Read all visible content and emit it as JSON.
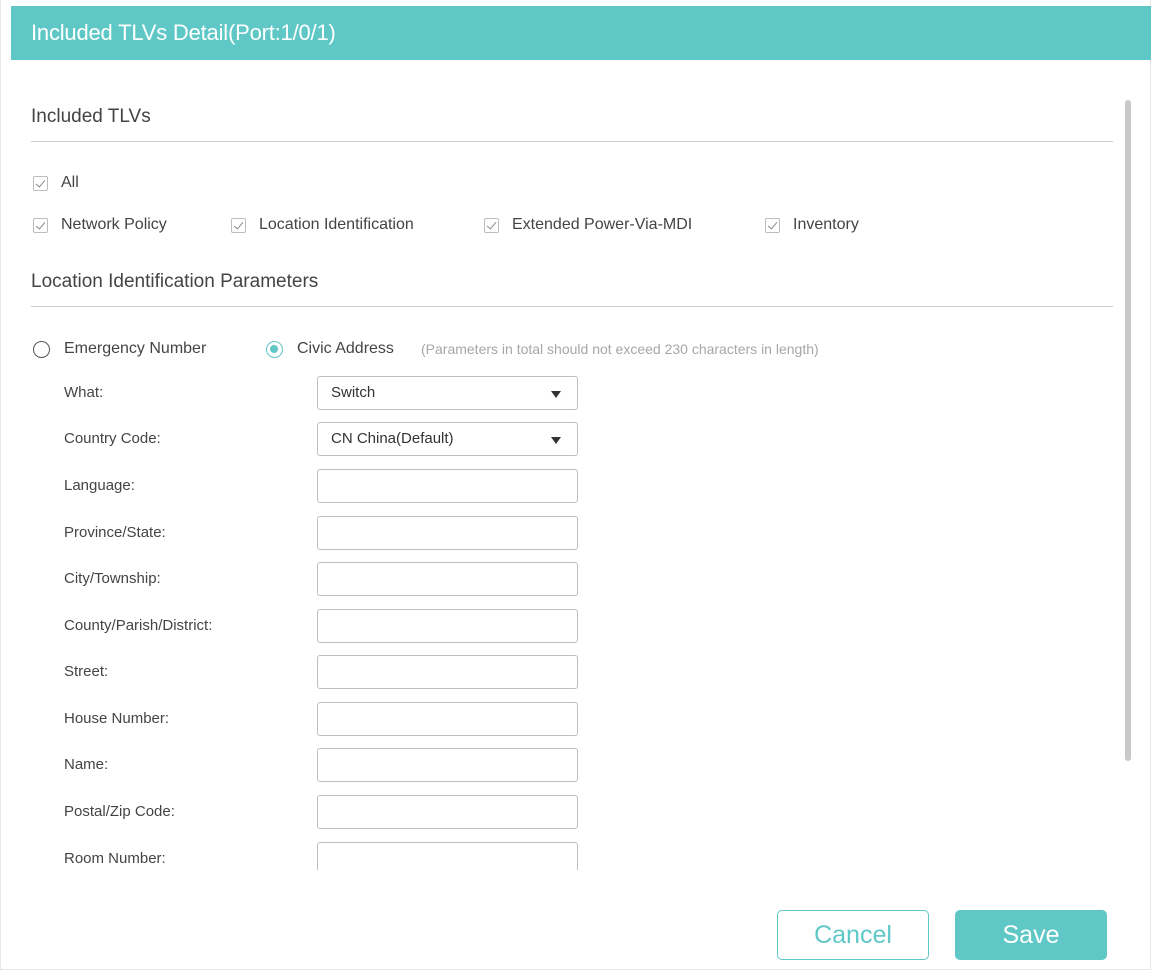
{
  "dialog": {
    "title": "Included TLVs Detail(Port:1/0/1)"
  },
  "included_tlvs": {
    "heading": "Included TLVs",
    "all": {
      "label": "All",
      "checked": true
    },
    "options": [
      {
        "label": "Network Policy",
        "checked": true
      },
      {
        "label": "Location Identification",
        "checked": true
      },
      {
        "label": "Extended Power-Via-MDI",
        "checked": true
      },
      {
        "label": "Inventory",
        "checked": true
      }
    ]
  },
  "location": {
    "heading": "Location Identification Parameters",
    "radios": [
      {
        "label": "Emergency Number",
        "checked": false
      },
      {
        "label": "Civic Address",
        "checked": true
      }
    ],
    "hint": "(Parameters in total should not exceed 230 characters in length)",
    "fields": {
      "what": {
        "label": "What:",
        "value": "Switch"
      },
      "country_code": {
        "label": "Country Code:",
        "value": "CN China(Default)"
      },
      "language": {
        "label": "Language:",
        "value": ""
      },
      "province": {
        "label": "Province/State:",
        "value": ""
      },
      "city": {
        "label": "City/Township:",
        "value": ""
      },
      "county": {
        "label": "County/Parish/District:",
        "value": ""
      },
      "street": {
        "label": "Street:",
        "value": ""
      },
      "house_number": {
        "label": "House Number:",
        "value": ""
      },
      "name": {
        "label": "Name:",
        "value": ""
      },
      "postal": {
        "label": "Postal/Zip Code:",
        "value": ""
      },
      "room": {
        "label": "Room Number:",
        "value": ""
      }
    }
  },
  "buttons": {
    "cancel": "Cancel",
    "save": "Save"
  },
  "colors": {
    "accent": "#5fc8c6"
  }
}
